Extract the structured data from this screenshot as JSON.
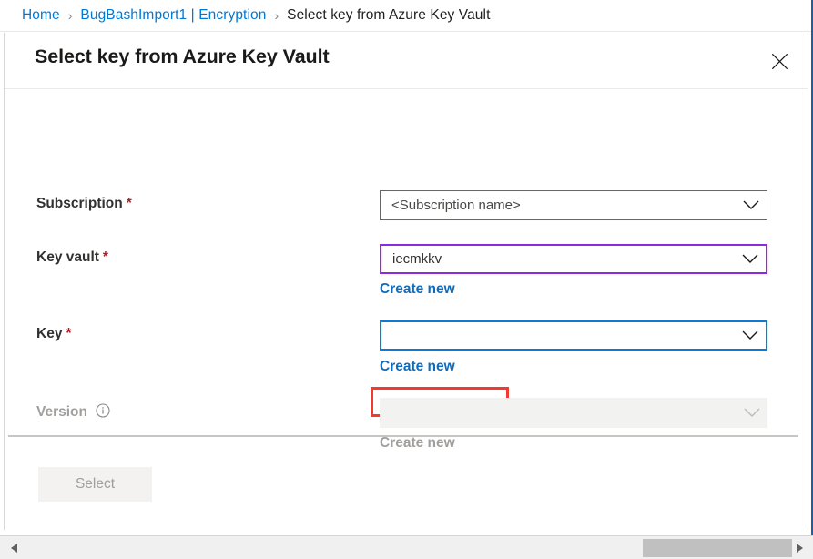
{
  "breadcrumb": {
    "items": [
      {
        "label": "Home",
        "current": false
      },
      {
        "label": "BugBashImport1 | Encryption",
        "current": false
      },
      {
        "label": "Select key from Azure Key Vault",
        "current": true
      }
    ],
    "separator": "›"
  },
  "blade": {
    "title": "Select key from Azure Key Vault",
    "close_icon": "close-icon"
  },
  "form": {
    "subscription": {
      "label": "Subscription",
      "required_marker": "*",
      "value": "<Subscription name>",
      "chevron_icon": "chevron-down-icon"
    },
    "key_vault": {
      "label": "Key vault",
      "required_marker": "*",
      "value": "iecmkkv",
      "create_new_label": "Create new",
      "chevron_icon": "chevron-down-icon"
    },
    "key": {
      "label": "Key",
      "required_marker": "*",
      "value": "",
      "create_new_label": "Create new",
      "chevron_icon": "chevron-down-icon"
    },
    "version": {
      "label": "Version",
      "info_icon": "info-icon",
      "value": "",
      "create_new_label": "Create new",
      "chevron_icon": "chevron-down-icon"
    }
  },
  "footer": {
    "select_label": "Select"
  },
  "scrollbar": {
    "left_arrow_icon": "caret-left-icon",
    "right_arrow_icon": "caret-right-icon"
  },
  "colors": {
    "link": "#0f6cbd",
    "breadcrumb_link": "#0078d4",
    "required_asterisk": "#a4262c",
    "focus_border": "#0f7ad4",
    "visited_border": "#8a2be2",
    "annotation": "#f03a32",
    "disabled_text": "#a19f9d"
  }
}
